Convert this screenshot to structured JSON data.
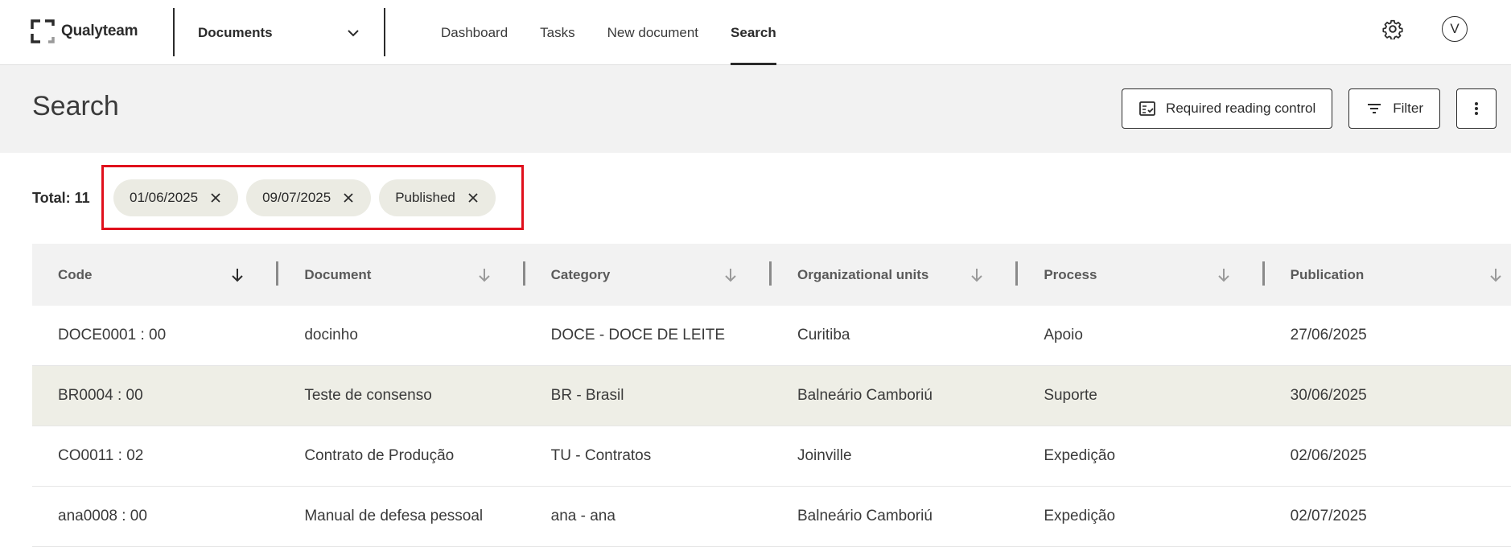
{
  "app": {
    "brand": "Qualyteam"
  },
  "module": {
    "selected": "Documents"
  },
  "nav": {
    "items": [
      {
        "label": "Dashboard",
        "active": false
      },
      {
        "label": "Tasks",
        "active": false
      },
      {
        "label": "New document",
        "active": false
      },
      {
        "label": "Search",
        "active": true
      }
    ]
  },
  "user": {
    "initial": "V"
  },
  "page": {
    "title": "Search"
  },
  "actions": {
    "required_reading": "Required reading control",
    "filter": "Filter"
  },
  "results": {
    "total": "Total: 11"
  },
  "filters": {
    "chips": [
      {
        "label": "01/06/2025"
      },
      {
        "label": "09/07/2025"
      },
      {
        "label": "Published"
      }
    ]
  },
  "table": {
    "columns": [
      {
        "label": "Code",
        "sorted": true
      },
      {
        "label": "Document",
        "sorted": false
      },
      {
        "label": "Category",
        "sorted": false
      },
      {
        "label": "Organizational units",
        "sorted": false
      },
      {
        "label": "Process",
        "sorted": false
      },
      {
        "label": "Publication",
        "sorted": false
      }
    ],
    "rows": [
      {
        "cells": [
          "DOCE0001 : 00",
          "docinho",
          "DOCE - DOCE DE LEITE",
          "Curitiba",
          "Apoio",
          "27/06/2025"
        ],
        "highlighted": false
      },
      {
        "cells": [
          "BR0004 : 00",
          "Teste de consenso",
          "BR - Brasil",
          "Balneário Camboriú",
          "Suporte",
          "30/06/2025"
        ],
        "highlighted": true
      },
      {
        "cells": [
          "CO0011 : 02",
          "Contrato de Produção",
          "TU - Contratos",
          "Joinville",
          "Expedição",
          "02/06/2025"
        ],
        "highlighted": false
      },
      {
        "cells": [
          "ana0008 : 00",
          "Manual de defesa pessoal",
          "ana - ana",
          "Balneário Camboriú",
          "Expedição",
          "02/07/2025"
        ],
        "highlighted": false
      }
    ]
  },
  "colors": {
    "accent_dark": "#2b2b2b",
    "header_band": "#f2f2f2",
    "chip_bg": "#ebebe3",
    "row_highlight": "#eeeee6",
    "annotation_red": "#e0101c"
  }
}
